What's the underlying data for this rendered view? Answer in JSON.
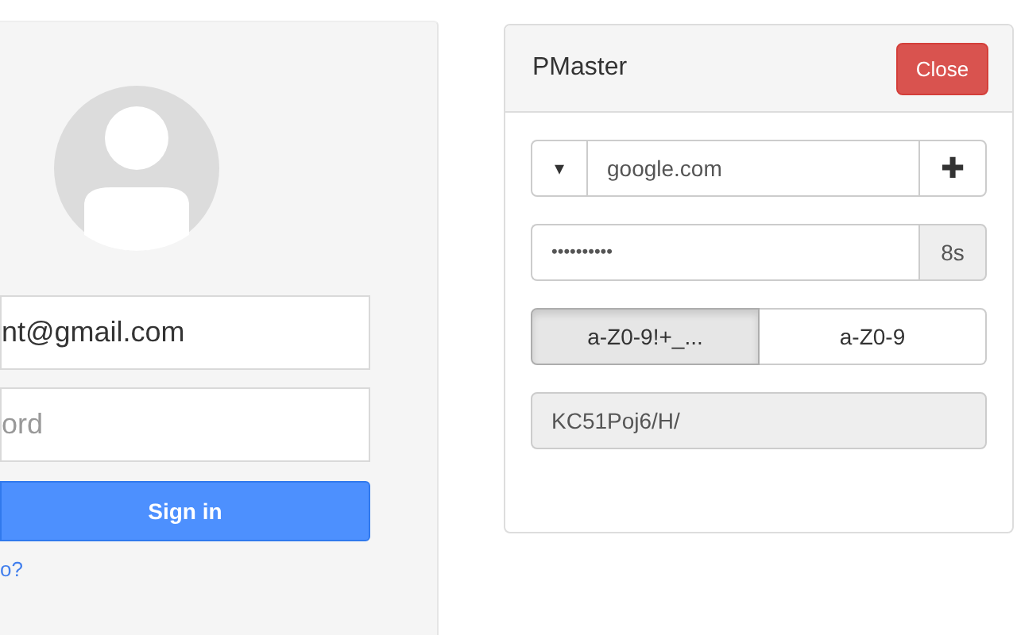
{
  "login": {
    "email": {
      "value": "nt@gmail.com"
    },
    "password": {
      "placeholder": "ord"
    },
    "sign_in": "Sign in",
    "help_link": "o?"
  },
  "panel": {
    "title": "PMaster",
    "close": "Close",
    "site": {
      "dropdown": "▾",
      "value": "google.com",
      "add": "✚"
    },
    "master_password": {
      "value": "••••••••••",
      "timer": "8s"
    },
    "charsets": [
      {
        "label": "a-Z0-9!+_...",
        "selected": true
      },
      {
        "label": "a-Z0-9",
        "selected": false
      }
    ],
    "generated": {
      "value": "KC51Poj6/H/"
    }
  }
}
